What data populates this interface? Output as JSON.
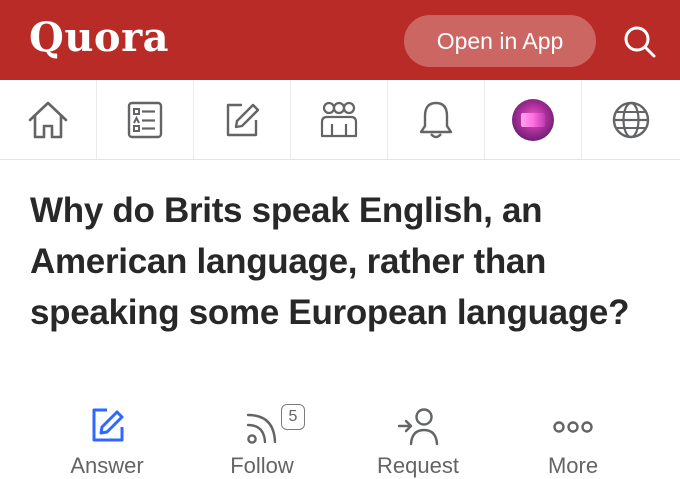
{
  "header": {
    "logo": "Quora",
    "open_in_app": "Open in App",
    "brand_color": "#b92b27"
  },
  "nav": {
    "items": [
      {
        "name": "home",
        "icon": "home-icon"
      },
      {
        "name": "answer",
        "icon": "answer-list-icon"
      },
      {
        "name": "write",
        "icon": "pencil-square-icon"
      },
      {
        "name": "spaces",
        "icon": "spaces-people-icon"
      },
      {
        "name": "notifications",
        "icon": "bell-icon"
      },
      {
        "name": "profile",
        "icon": "avatar"
      },
      {
        "name": "languages",
        "icon": "globe-icon"
      }
    ]
  },
  "question": {
    "title": "Why do Brits speak English, an American language, rather than speaking some European language?"
  },
  "actions": {
    "answer_label": "Answer",
    "follow_label": "Follow",
    "follow_count": "5",
    "request_label": "Request",
    "more_label": "More",
    "accent_color": "#2e69ff"
  }
}
